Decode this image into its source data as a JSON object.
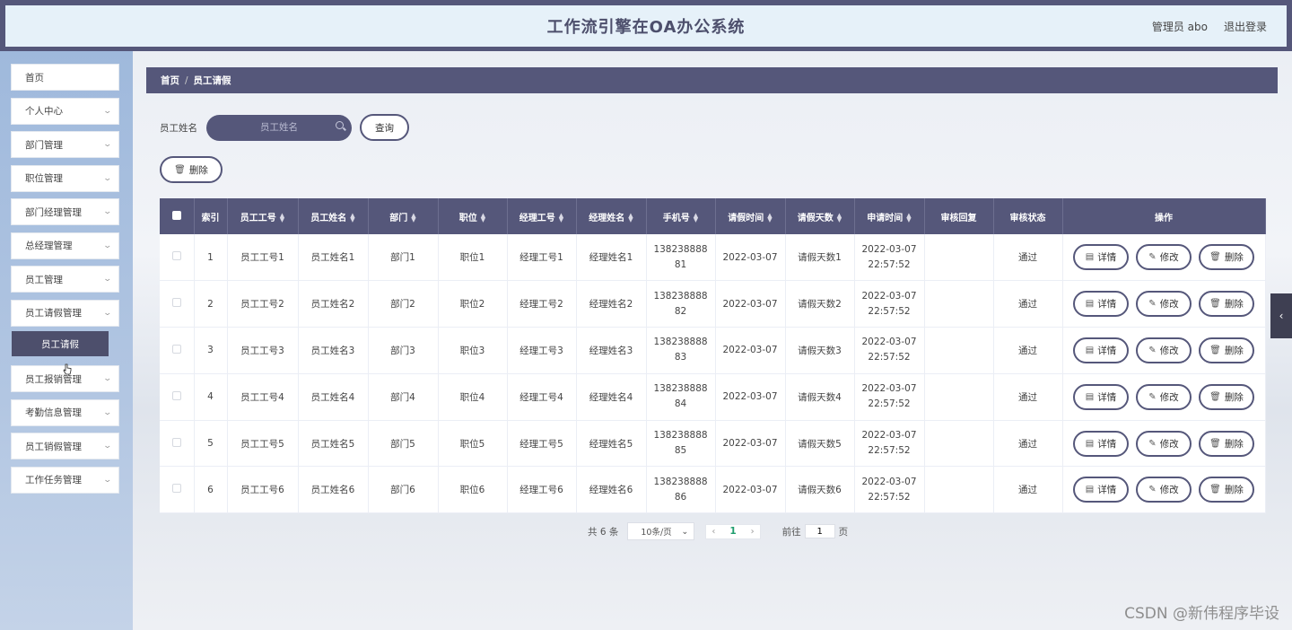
{
  "header": {
    "title": "工作流引擎在OA办公系统",
    "user_label": "管理员 abo",
    "logout": "退出登录"
  },
  "sidebar": {
    "items": [
      {
        "label": "首页",
        "has_arrow": false
      },
      {
        "label": "个人中心",
        "has_arrow": true
      },
      {
        "label": "部门管理",
        "has_arrow": true
      },
      {
        "label": "职位管理",
        "has_arrow": true
      },
      {
        "label": "部门经理管理",
        "has_arrow": true
      },
      {
        "label": "总经理管理",
        "has_arrow": true
      },
      {
        "label": "员工管理",
        "has_arrow": true
      },
      {
        "label": "员工请假管理",
        "has_arrow": true
      },
      {
        "label": "员工报销管理",
        "has_arrow": true
      },
      {
        "label": "考勤信息管理",
        "has_arrow": true
      },
      {
        "label": "员工销假管理",
        "has_arrow": true
      },
      {
        "label": "工作任务管理",
        "has_arrow": true
      }
    ],
    "active_sub": "员工请假"
  },
  "breadcrumb": {
    "home": "首页",
    "separator": "/",
    "current": "员工请假"
  },
  "search": {
    "label": "员工姓名",
    "placeholder": "员工姓名",
    "query_button": "查询"
  },
  "toolbar": {
    "delete_label": "删除"
  },
  "table": {
    "columns": [
      "索引",
      "员工工号",
      "员工姓名",
      "部门",
      "职位",
      "经理工号",
      "经理姓名",
      "手机号",
      "请假时间",
      "请假天数",
      "申请时间",
      "审核回复",
      "审核状态",
      "操作"
    ],
    "rows": [
      {
        "idx": "1",
        "emp_no": "员工工号1",
        "emp_name": "员工姓名1",
        "dept": "部门1",
        "pos": "职位1",
        "mgr_no": "经理工号1",
        "mgr_name": "经理姓名1",
        "phone_a": "138238888",
        "phone_b": "81",
        "leave_date": "2022-03-07",
        "days": "请假天数1",
        "apply_date": "2022-03-07",
        "apply_time": "22:57:52",
        "reply": "",
        "status": "通过"
      },
      {
        "idx": "2",
        "emp_no": "员工工号2",
        "emp_name": "员工姓名2",
        "dept": "部门2",
        "pos": "职位2",
        "mgr_no": "经理工号2",
        "mgr_name": "经理姓名2",
        "phone_a": "138238888",
        "phone_b": "82",
        "leave_date": "2022-03-07",
        "days": "请假天数2",
        "apply_date": "2022-03-07",
        "apply_time": "22:57:52",
        "reply": "",
        "status": "通过"
      },
      {
        "idx": "3",
        "emp_no": "员工工号3",
        "emp_name": "员工姓名3",
        "dept": "部门3",
        "pos": "职位3",
        "mgr_no": "经理工号3",
        "mgr_name": "经理姓名3",
        "phone_a": "138238888",
        "phone_b": "83",
        "leave_date": "2022-03-07",
        "days": "请假天数3",
        "apply_date": "2022-03-07",
        "apply_time": "22:57:52",
        "reply": "",
        "status": "通过"
      },
      {
        "idx": "4",
        "emp_no": "员工工号4",
        "emp_name": "员工姓名4",
        "dept": "部门4",
        "pos": "职位4",
        "mgr_no": "经理工号4",
        "mgr_name": "经理姓名4",
        "phone_a": "138238888",
        "phone_b": "84",
        "leave_date": "2022-03-07",
        "days": "请假天数4",
        "apply_date": "2022-03-07",
        "apply_time": "22:57:52",
        "reply": "",
        "status": "通过"
      },
      {
        "idx": "5",
        "emp_no": "员工工号5",
        "emp_name": "员工姓名5",
        "dept": "部门5",
        "pos": "职位5",
        "mgr_no": "经理工号5",
        "mgr_name": "经理姓名5",
        "phone_a": "138238888",
        "phone_b": "85",
        "leave_date": "2022-03-07",
        "days": "请假天数5",
        "apply_date": "2022-03-07",
        "apply_time": "22:57:52",
        "reply": "",
        "status": "通过"
      },
      {
        "idx": "6",
        "emp_no": "员工工号6",
        "emp_name": "员工姓名6",
        "dept": "部门6",
        "pos": "职位6",
        "mgr_no": "经理工号6",
        "mgr_name": "经理姓名6",
        "phone_a": "138238888",
        "phone_b": "86",
        "leave_date": "2022-03-07",
        "days": "请假天数6",
        "apply_date": "2022-03-07",
        "apply_time": "22:57:52",
        "reply": "",
        "status": "通过"
      }
    ],
    "actions": {
      "detail": "详情",
      "edit": "修改",
      "delete": "删除"
    }
  },
  "pagination": {
    "total": "共 6 条",
    "page_size": "10条/页",
    "current_page": "1",
    "goto_label": "前往",
    "goto_value": "1",
    "page_suffix": "页"
  },
  "watermark": "CSDN @新伟程序毕设",
  "colors": {
    "primary": "#55577a",
    "header_bg": "#e6f1f9",
    "sidebar_bg": "#a8c0e0",
    "page_active": "#1f9d6e"
  }
}
